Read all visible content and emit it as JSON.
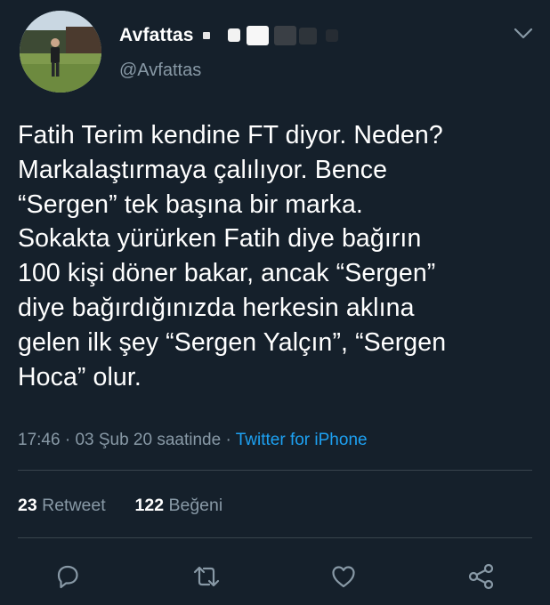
{
  "header": {
    "display_name": "Avfattas",
    "handle": "@Avfattas"
  },
  "tweet": {
    "text": "Fatih Terim kendine FT diyor. Neden?\nMarkalaştırmaya çalılıyor. Bence\n“Sergen” tek başına bir marka.\nSokakta yürürken Fatih diye bağırın\n100 kişi döner bakar, ancak “Sergen”\ndiye bağırdığınızda herkesin aklına\ngelen ilk şey “Sergen Yalçın”, “Sergen\nHoca” olur.",
    "time": "17:46",
    "separator1": " · ",
    "date": "03 Şub 20 saatinde",
    "separator2": " · ",
    "source": "Twitter for iPhone"
  },
  "stats": {
    "retweet_count": "23",
    "retweet_label": "Retweet",
    "like_count": "122",
    "like_label": "Beğeni"
  },
  "icons": {
    "reply": "reply-icon",
    "retweet": "retweet-icon",
    "like": "heart-icon",
    "share": "share-icon",
    "more": "chevron-down-icon"
  },
  "colors": {
    "background": "#15202b",
    "primary_text": "#ffffff",
    "secondary_text": "#8899a6",
    "link": "#1da1f2",
    "divider": "#38444d"
  }
}
